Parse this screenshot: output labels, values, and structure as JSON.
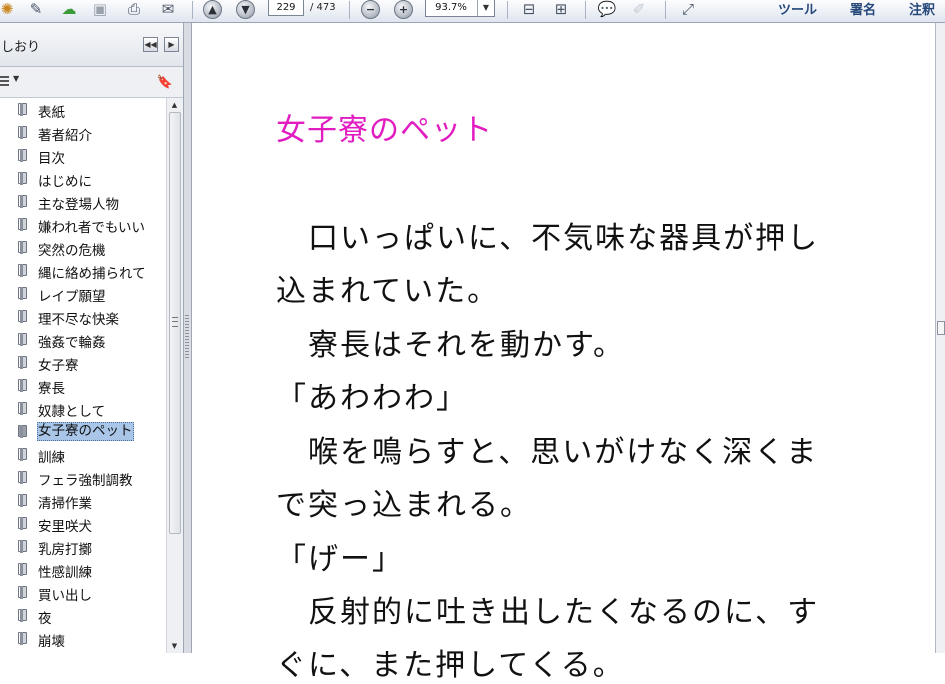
{
  "toolbar": {
    "page_current": "229",
    "page_total": "/ 473",
    "zoom": "93.7%",
    "tools_label": "ツール",
    "sign_label": "署名",
    "comment_label": "注釈"
  },
  "bookmarks_panel": {
    "title": "しおり",
    "items": [
      {
        "label": "表紙"
      },
      {
        "label": "著者紹介"
      },
      {
        "label": "目次"
      },
      {
        "label": "はじめに"
      },
      {
        "label": "主な登場人物"
      },
      {
        "label": "嫌われ者でもいい"
      },
      {
        "label": "突然の危機"
      },
      {
        "label": "縄に絡め捕られて"
      },
      {
        "label": "レイプ願望"
      },
      {
        "label": "理不尽な快楽"
      },
      {
        "label": "強姦で輪姦"
      },
      {
        "label": "女子寮"
      },
      {
        "label": "寮長"
      },
      {
        "label": "奴隷として"
      },
      {
        "label": "女子寮のペット",
        "selected": true
      },
      {
        "label": "訓練"
      },
      {
        "label": "フェラ強制調教"
      },
      {
        "label": "清掃作業"
      },
      {
        "label": "安里咲犬"
      },
      {
        "label": "乳房打擲"
      },
      {
        "label": "性感訓練"
      },
      {
        "label": "買い出し"
      },
      {
        "label": "夜"
      },
      {
        "label": "崩壊"
      }
    ]
  },
  "document": {
    "chapter_title": "女子寮のペット",
    "title_color": "#e11cc1",
    "lines": [
      "　口いっぱいに、不気味な器具が押し",
      "込まれていた。",
      "　寮長はそれを動かす。",
      "「あわわわ」",
      "　喉を鳴らすと、思いがけなく深くま",
      "で突っ込まれる。",
      "「げー」",
      "　反射的に吐き出したくなるのに、す",
      "ぐに、また押してくる。"
    ]
  }
}
